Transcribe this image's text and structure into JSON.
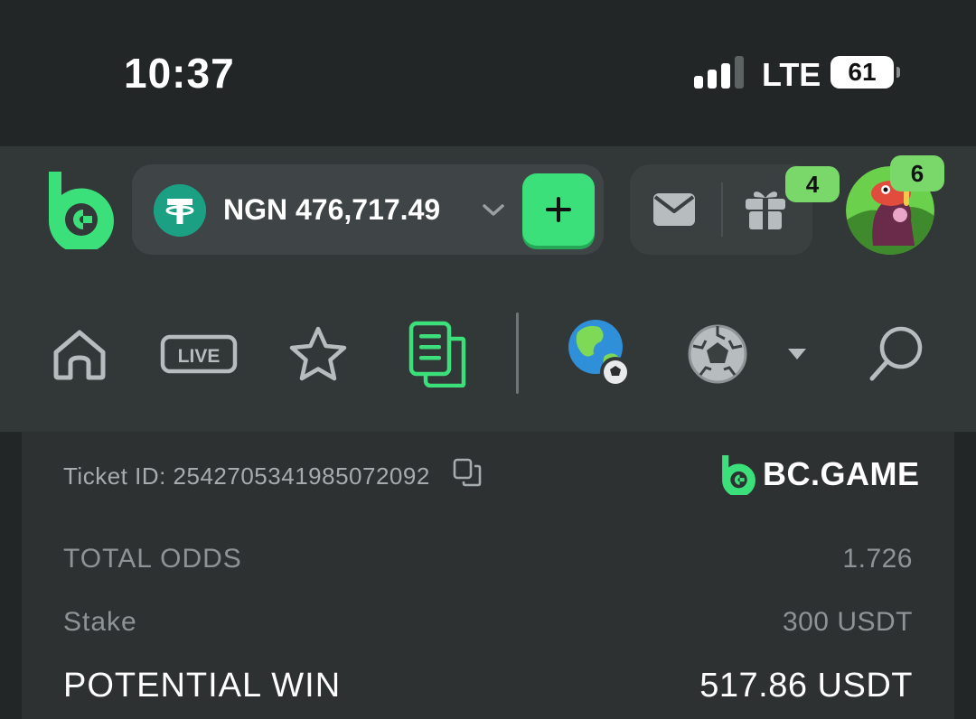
{
  "status_bar": {
    "time": "10:37",
    "network": "LTE",
    "battery": "61"
  },
  "header": {
    "wallet": {
      "balance": "NGN 476,717.49",
      "currency_icon": "tether-icon",
      "deposit_icon": "plus-icon"
    },
    "gift_badge": "4",
    "avatar_badge": "6"
  },
  "nav": {
    "items": [
      "home-icon",
      "live-icon",
      "star-icon",
      "betslip-icon",
      "globe-soccer-icon",
      "soccer-ball-icon",
      "dropdown-icon",
      "search-icon"
    ],
    "live_label": "LIVE",
    "active_item": "betslip-icon"
  },
  "ticket": {
    "id_text": "Ticket ID: 2542705341985072092",
    "brand": "BC.GAME",
    "rows": [
      {
        "label": "TOTAL ODDS",
        "value": "1.726"
      },
      {
        "label": "Stake",
        "value": "300 USDT"
      },
      {
        "label": "POTENTIAL WIN",
        "value": "517.86 USDT"
      }
    ]
  },
  "colors": {
    "accent_green": "#3ce07a",
    "badge_green": "#7ad86a",
    "background": "#232627",
    "header_bg": "#323738"
  }
}
